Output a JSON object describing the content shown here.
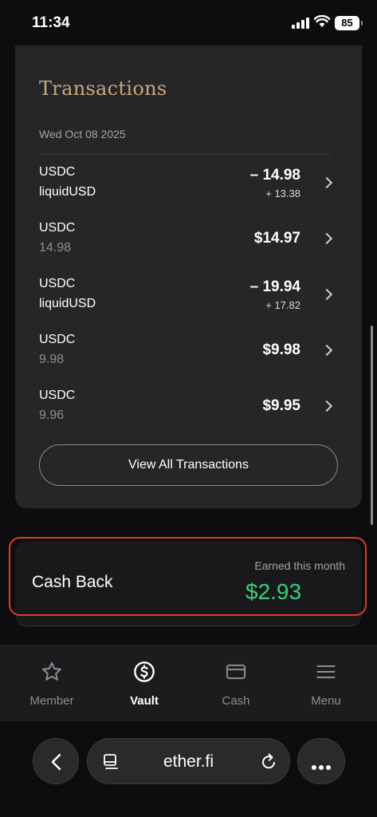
{
  "status_bar": {
    "time": "11:34",
    "battery": "85"
  },
  "transactions": {
    "title": "Transactions",
    "date": "Wed Oct 08 2025",
    "items": [
      {
        "name": "USDC",
        "sub": "liquidUSD",
        "amount": "– 14.98",
        "secondary": "+ 13.38"
      },
      {
        "name": "USDC",
        "sub": "14.98",
        "amount": "$14.97",
        "secondary": ""
      },
      {
        "name": "USDC",
        "sub": "liquidUSD",
        "amount": "– 19.94",
        "secondary": "+ 17.82"
      },
      {
        "name": "USDC",
        "sub": "9.98",
        "amount": "$9.98",
        "secondary": ""
      },
      {
        "name": "USDC",
        "sub": "9.96",
        "amount": "$9.95",
        "secondary": ""
      }
    ],
    "view_all_label": "View All Transactions"
  },
  "cashback": {
    "title": "Cash Back",
    "earned_label": "Earned this month",
    "earned_value": "$2.93",
    "value_color": "#35d07f"
  },
  "nav": {
    "items": [
      {
        "label": "Member",
        "icon": "star-icon"
      },
      {
        "label": "Vault",
        "icon": "dollar-circle-icon",
        "active": true
      },
      {
        "label": "Cash",
        "icon": "card-icon"
      },
      {
        "label": "Menu",
        "icon": "menu-icon"
      }
    ]
  },
  "browser": {
    "url": "ether.fi"
  }
}
